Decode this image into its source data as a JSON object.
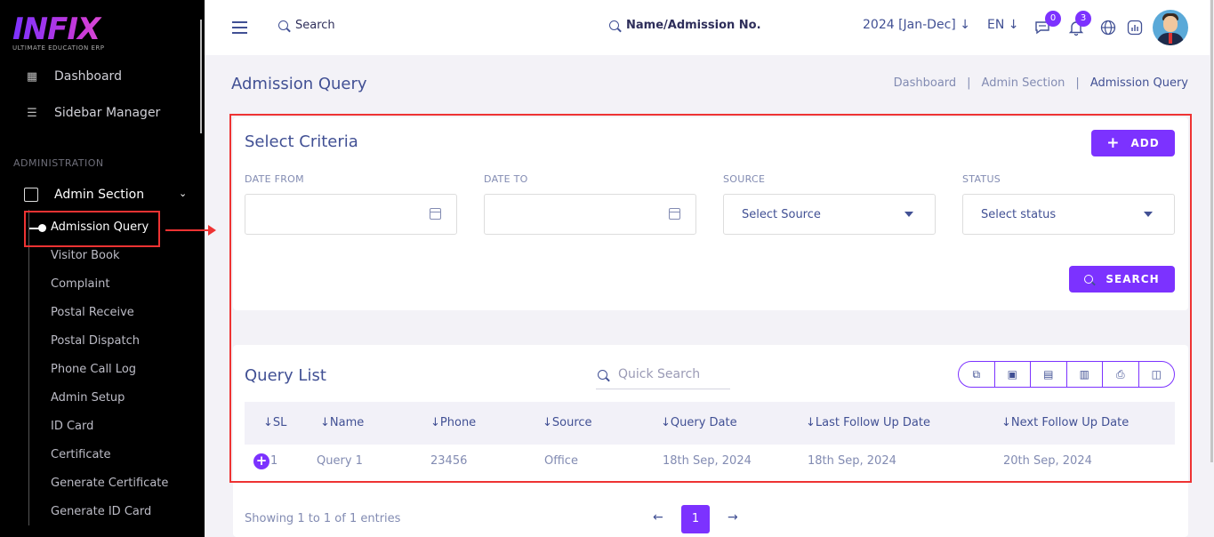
{
  "logo": {
    "name": "INFIX",
    "tagline": "ULTIMATE EDUCATION ERP"
  },
  "sidebar": {
    "items": [
      {
        "label": "Dashboard",
        "icon": "grid-icon"
      },
      {
        "label": "Sidebar Manager",
        "icon": "list-icon"
      }
    ],
    "section_label": "ADMINISTRATION",
    "group": {
      "label": "Admin Section",
      "icon": "admin-icon"
    },
    "active_sub": "Admission Query",
    "subs": [
      "Visitor Book",
      "Complaint",
      "Postal Receive",
      "Postal Dispatch",
      "Phone Call Log",
      "Admin Setup",
      "ID Card",
      "Certificate",
      "Generate Certificate",
      "Generate ID Card"
    ]
  },
  "topbar": {
    "search_label": "Search",
    "name_search_label": "Name/Admission No.",
    "year": "2024 [Jan-Dec]",
    "lang": "EN",
    "message_count": "0",
    "notification_count": "3"
  },
  "page": {
    "title": "Admission Query",
    "breadcrumb": [
      "Dashboard",
      "Admin Section",
      "Admission Query"
    ]
  },
  "criteria": {
    "title": "Select Criteria",
    "add_label": "ADD",
    "date_from_label": "DATE FROM",
    "date_to_label": "DATE TO",
    "source_label": "SOURCE",
    "status_label": "STATUS",
    "source_value": "Select Source",
    "status_value": "Select status",
    "search_label": "SEARCH"
  },
  "query_list": {
    "title": "Query List",
    "quick_search_placeholder": "Quick Search",
    "columns": [
      "SL",
      "Name",
      "Phone",
      "Source",
      "Query Date",
      "Last Follow Up Date",
      "Next Follow Up Date"
    ],
    "rows": [
      {
        "sl": "1",
        "name": "Query 1",
        "phone": "23456",
        "source": "Office",
        "query_date": "18th Sep, 2024",
        "last_follow": "18th Sep, 2024",
        "next_follow": "20th Sep, 2024"
      }
    ],
    "showing": "Showing 1 to 1 of 1 entries",
    "current_page": "1"
  },
  "colors": {
    "accent": "#7c32ff",
    "highlight": "#e33333",
    "text": "#415094"
  }
}
